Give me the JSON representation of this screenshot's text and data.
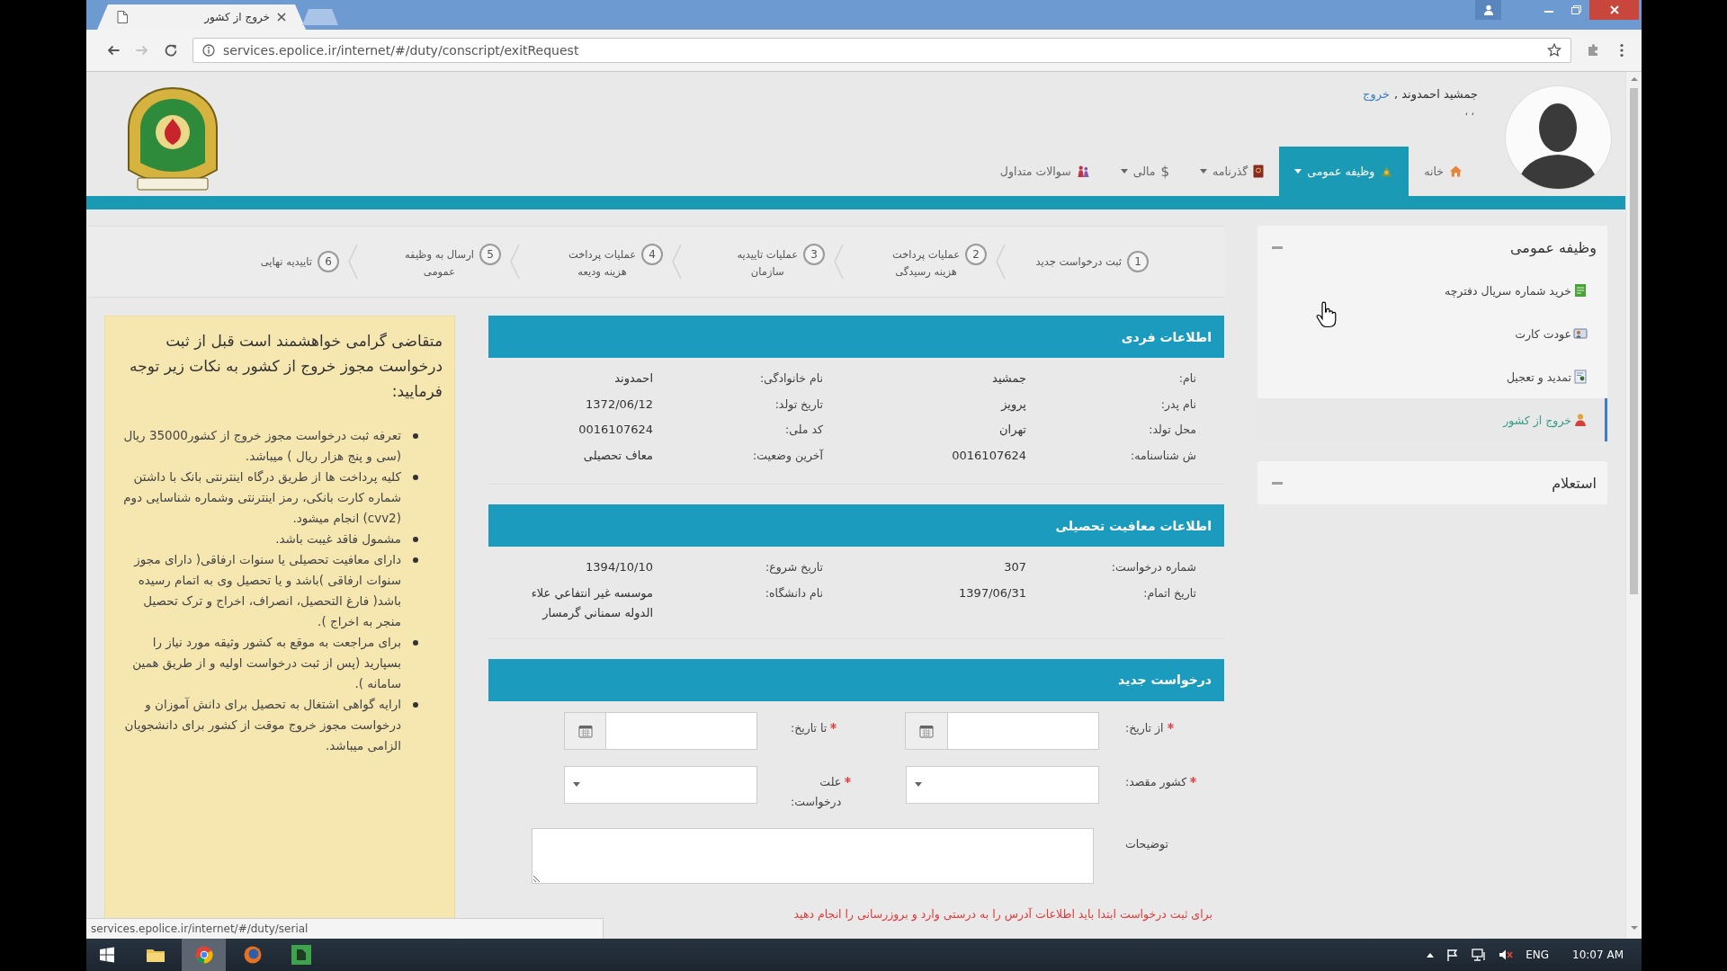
{
  "browser": {
    "tab_title": "خروج از کشور",
    "url": "services.epolice.ir/internet/#/duty/conscript/exitRequest",
    "status_url": "services.epolice.ir/internet/#/duty/serial"
  },
  "header": {
    "user_name": "جمشید احمدوند ,",
    "logout_link": "خروج",
    "user_note": "، ،",
    "nav": [
      {
        "label": "خانه",
        "selected": false,
        "dropdown": false
      },
      {
        "label": "وظیفه عمومی",
        "selected": true,
        "dropdown": true
      },
      {
        "label": "گذرنامه",
        "selected": false,
        "dropdown": true
      },
      {
        "label": "مالی",
        "symbol": "$",
        "selected": false,
        "dropdown": true
      },
      {
        "label": "سوالات متداول",
        "selected": false,
        "dropdown": false
      }
    ]
  },
  "steps": [
    {
      "number": "1",
      "label": "ثبت درخواست جدید"
    },
    {
      "number": "2",
      "label": "عملیات پرداخت\nهزینه رسیدگی"
    },
    {
      "number": "3",
      "label": "عملیات تاییدیه\nسازمان"
    },
    {
      "number": "4",
      "label": "عملیات پرداخت\nهزینه ودیعه"
    },
    {
      "number": "5",
      "label": "ارسال به وظیفه\nعمومی"
    },
    {
      "number": "6",
      "label": "تاییدیه نهایی"
    }
  ],
  "sections": [
    {
      "title": "اطلاعات فردی",
      "fields": [
        {
          "label": "نام:",
          "value": "جمشید"
        },
        {
          "label": "نام خانوادگی:",
          "value": "احمدوند"
        },
        {
          "label": "نام پدر:",
          "value": "پرویز"
        },
        {
          "label": "تاریخ تولد:",
          "value": "1372/06/12"
        },
        {
          "label": "محل تولد:",
          "value": "تهران"
        },
        {
          "label": "کد ملی:",
          "value": "0016107624"
        },
        {
          "label": "ش شناسنامه:",
          "value": "0016107624"
        },
        {
          "label": "آخرین وضعیت:",
          "value": "معاف تحصیلی"
        }
      ]
    },
    {
      "title": "اطلاعات معافیت تحصیلی",
      "fields": [
        {
          "label": "شماره درخواست:",
          "value": "307"
        },
        {
          "label": "تاریخ شروع:",
          "value": "1394/10/10"
        },
        {
          "label": "تاریخ اتمام:",
          "value": "1397/06/31"
        },
        {
          "label": "نام دانشگاه:",
          "value": "موسسه غير انتفاعي علاء\nالدوله سمناني گرمسار"
        }
      ]
    }
  ],
  "request_form": {
    "title": "درخواست جدید",
    "fields": [
      {
        "label": "از تاریخ:",
        "required": true,
        "kind": "date"
      },
      {
        "label": "تا تاریخ:",
        "required": true,
        "kind": "date"
      },
      {
        "label": "کشور مقصد:",
        "required": true,
        "kind": "select"
      },
      {
        "label": "علت\nدرخواست:",
        "required": true,
        "kind": "select"
      },
      {
        "label": "توضیحات",
        "required": false,
        "kind": "textarea"
      }
    ],
    "warning": "برای ثبت درخواست ابتدا باید اطلاعات آدرس را به درستی وارد و بروزرسانی را انجام دهید"
  },
  "notice": {
    "intro": "متقاضی گرامی خواهشمند است قبل از ثبت درخواست مجوز خروج از کشور به نکات زیر توجه فرمایید:",
    "items": [
      "تعرفه ثبت درخواست مجوز خروج از کشور35000 ریال (سی و پنج هزار ریال ) میباشد.",
      "کلیه پرداخت ها از طریق درگاه اینترنتی بانک با داشتن شماره کارت بانکی، رمز اینترنتی وشماره شناسایی دوم (cvv2) انجام میشود.",
      "مشمول فاقد غیبت باشد.",
      "دارای معافیت تحصیلی یا سنوات ارفاقی( دارای مجوز سنوات ارفاقی )باشد و یا تحصیل وی به اتمام رسیده باشد( فارغ التحصیل، انصراف، اخراج و ترک تحصیل منجر به اخراج ).",
      "برای مراجعت به موقع به کشور وثیقه مورد نیاز را بسپارید (پس از ثبت درخواست اولیه و از طریق همین سامانه ).",
      "ارایه گواهی اشتغال به تحصیل برای دانش آموزان و درخواست مجوز خروج موقت از کشور برای دانشجویان الزامی میباشد."
    ]
  },
  "sidebar": {
    "panels": [
      {
        "title": "وظیفه عمومی",
        "items": [
          {
            "label": "خرید شماره سریال دفترچه",
            "selected": false
          },
          {
            "label": "عودت کارت",
            "selected": false
          },
          {
            "label": "تمدید و تعجیل",
            "selected": false
          },
          {
            "label": "خروج از کشور",
            "selected": true
          }
        ]
      },
      {
        "title": "استعلام"
      }
    ]
  },
  "taskbar": {
    "apps": [
      {
        "selected": false
      },
      {
        "selected": true
      },
      {
        "selected": false
      },
      {
        "selected": false
      }
    ],
    "language": "ENG",
    "time": "10:07 AM"
  }
}
